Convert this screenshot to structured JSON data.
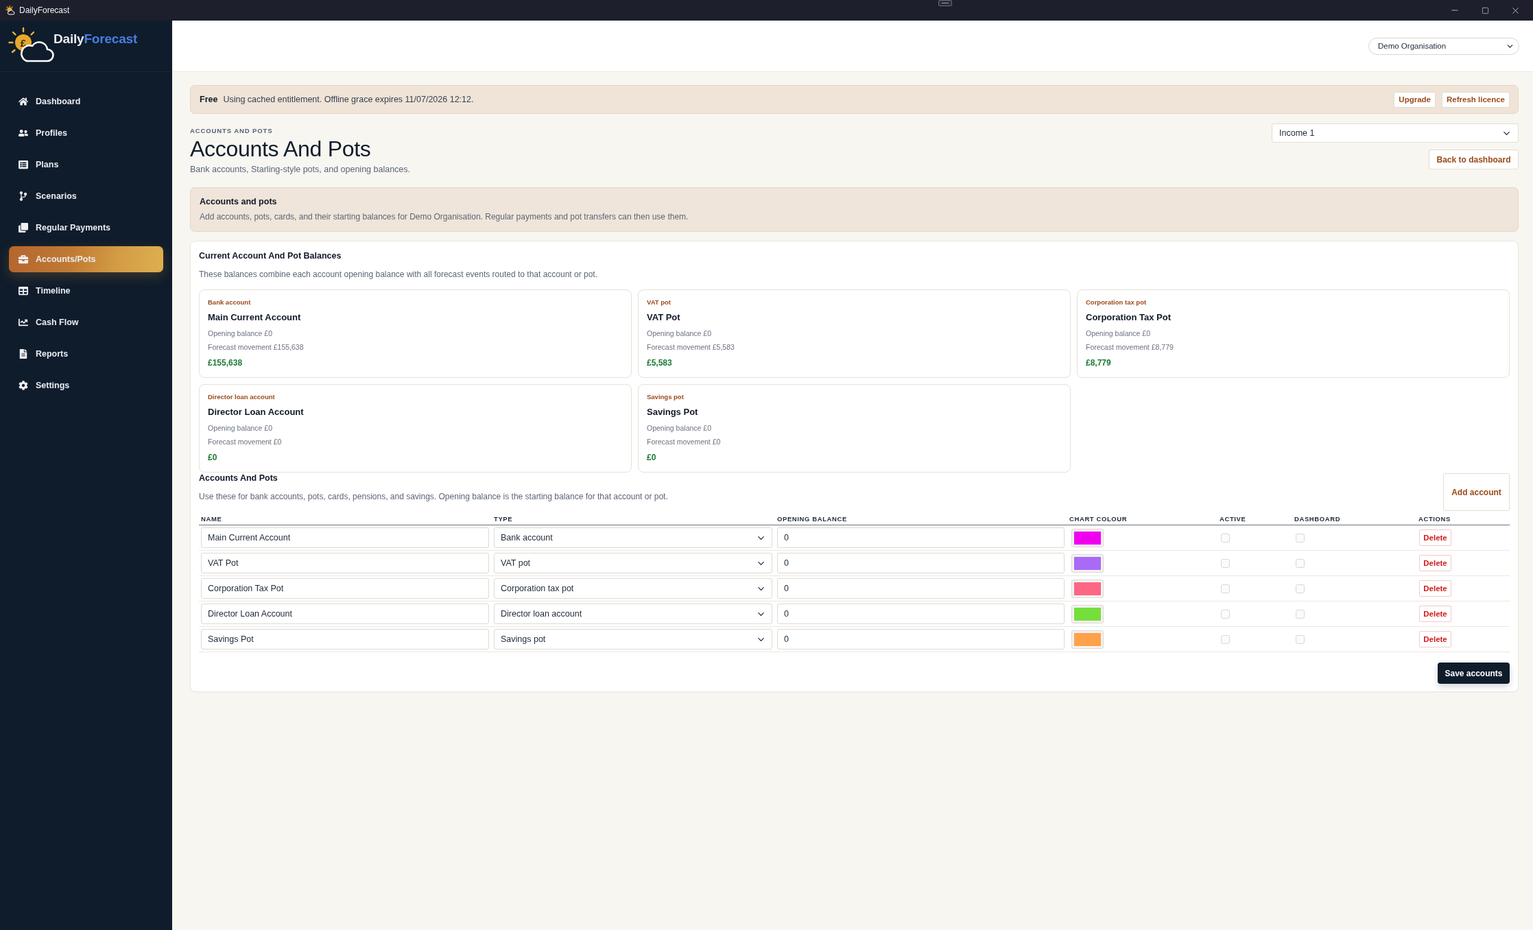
{
  "window": {
    "title": "DailyForecast"
  },
  "sidebar": {
    "brand": {
      "symbol": "£",
      "first": "Daily",
      "second": "Forecast"
    },
    "items": [
      {
        "label": "Dashboard",
        "selected": false
      },
      {
        "label": "Profiles",
        "selected": false
      },
      {
        "label": "Plans",
        "selected": false
      },
      {
        "label": "Scenarios",
        "selected": false
      },
      {
        "label": "Regular Payments",
        "selected": false
      },
      {
        "label": "Accounts/Pots",
        "selected": true
      },
      {
        "label": "Timeline",
        "selected": false
      },
      {
        "label": "Cash Flow",
        "selected": false
      },
      {
        "label": "Reports",
        "selected": false
      },
      {
        "label": "Settings",
        "selected": false
      }
    ]
  },
  "header": {
    "organisation_select": {
      "value": "Demo Organisation"
    }
  },
  "licence_banner": {
    "plan": "Free",
    "message": "Using cached entitlement. Offline grace expires 11/07/2026 12:12.",
    "buttons": [
      "Upgrade",
      "Refresh licence"
    ]
  },
  "page": {
    "eyebrow": "ACCOUNTS AND POTS",
    "title": "Accounts And Pots",
    "subtitle": "Bank accounts, Starling-style pots, and opening balances.",
    "plan_select": {
      "value": "Income 1"
    },
    "back_button": "Back to dashboard"
  },
  "notice": {
    "title": "Accounts and pots",
    "text": "Add accounts, pots, cards, and their starting balances for Demo Organisation. Regular payments and pot transfers can then use them."
  },
  "balances": {
    "title": "Current Account And Pot Balances",
    "description": "These balances combine each account opening balance with all forecast events routed to that account or pot.",
    "cards": [
      {
        "type": "Bank account",
        "name": "Main Current Account",
        "opening": "Opening balance £0",
        "movement": "Forecast movement £155,638",
        "balance": "£155,638"
      },
      {
        "type": "VAT pot",
        "name": "VAT Pot",
        "opening": "Opening balance £0",
        "movement": "Forecast movement £5,583",
        "balance": "£5,583"
      },
      {
        "type": "Corporation tax pot",
        "name": "Corporation Tax Pot",
        "opening": "Opening balance £0",
        "movement": "Forecast movement £8,779",
        "balance": "£8,779"
      },
      {
        "type": "Director loan account",
        "name": "Director Loan Account",
        "opening": "Opening balance £0",
        "movement": "Forecast movement £0",
        "balance": "£0"
      },
      {
        "type": "Savings pot",
        "name": "Savings Pot",
        "opening": "Opening balance £0",
        "movement": "Forecast movement £0",
        "balance": "£0"
      }
    ]
  },
  "accounts": {
    "title": "Accounts And Pots",
    "description": "Use these for bank accounts, pots, cards, pensions, and savings. Opening balance is the starting balance for that account or pot.",
    "add_button": "Add account",
    "columns": [
      "NAME",
      "TYPE",
      "OPENING BALANCE",
      "CHART COLOUR",
      "ACTIVE",
      "DASHBOARD",
      "ACTIONS"
    ],
    "rows": [
      {
        "name": "Main Current Account",
        "type": "Bank account",
        "opening_balance": "0",
        "color": "#f000f0",
        "active": false,
        "dashboard": false,
        "action": "Delete"
      },
      {
        "name": "VAT Pot",
        "type": "VAT pot",
        "opening_balance": "0",
        "color": "#a96af8",
        "active": false,
        "dashboard": false,
        "action": "Delete"
      },
      {
        "name": "Corporation Tax Pot",
        "type": "Corporation tax pot",
        "opening_balance": "0",
        "color": "#fd6685",
        "active": false,
        "dashboard": false,
        "action": "Delete"
      },
      {
        "name": "Director Loan Account",
        "type": "Director loan account",
        "opening_balance": "0",
        "color": "#74df3a",
        "active": false,
        "dashboard": false,
        "action": "Delete"
      },
      {
        "name": "Savings Pot",
        "type": "Savings pot",
        "opening_balance": "0",
        "color": "#ffa14a",
        "active": false,
        "dashboard": false,
        "action": "Delete"
      }
    ],
    "save_button": "Save accounts"
  }
}
